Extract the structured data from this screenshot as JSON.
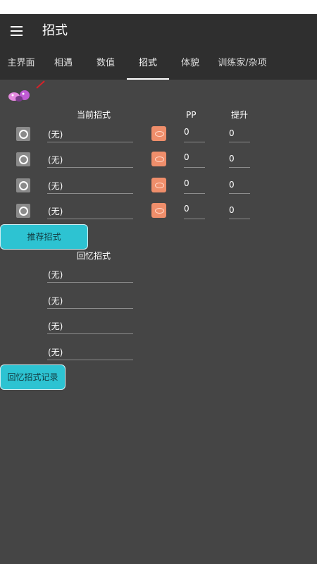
{
  "appbar": {
    "title": "招式"
  },
  "tabs": [
    {
      "label": "主界面"
    },
    {
      "label": "相遇"
    },
    {
      "label": "数值"
    },
    {
      "label": "招式"
    },
    {
      "label": "体貌"
    },
    {
      "label": "训练家/杂项"
    }
  ],
  "active_tab": "招式",
  "current_moves": {
    "header": "当前招式",
    "pp_header": "PP",
    "ppup_header": "提升",
    "rows": [
      {
        "move": "(无)",
        "pp": "0",
        "ppup": "0"
      },
      {
        "move": "(无)",
        "pp": "0",
        "ppup": "0"
      },
      {
        "move": "(无)",
        "pp": "0",
        "ppup": "0"
      },
      {
        "move": "(无)",
        "pp": "0",
        "ppup": "0"
      }
    ]
  },
  "recommend_button": "推荐招式",
  "relearn_moves": {
    "header": "回忆招式",
    "rows": [
      {
        "move": "(无)"
      },
      {
        "move": "(无)"
      },
      {
        "move": "(无)"
      },
      {
        "move": "(无)"
      }
    ]
  },
  "relearn_record_button": "回忆招式记录",
  "colors": {
    "background": "#454545",
    "appbar": "#2f2f2f",
    "accent_button": "#2dc3d2",
    "type_icon": "#ef8e6b"
  },
  "icons": {
    "menu": "hamburger-icon",
    "ball": "ball-icon",
    "type": "type-icon",
    "sprite": "pokemon-sprite"
  }
}
